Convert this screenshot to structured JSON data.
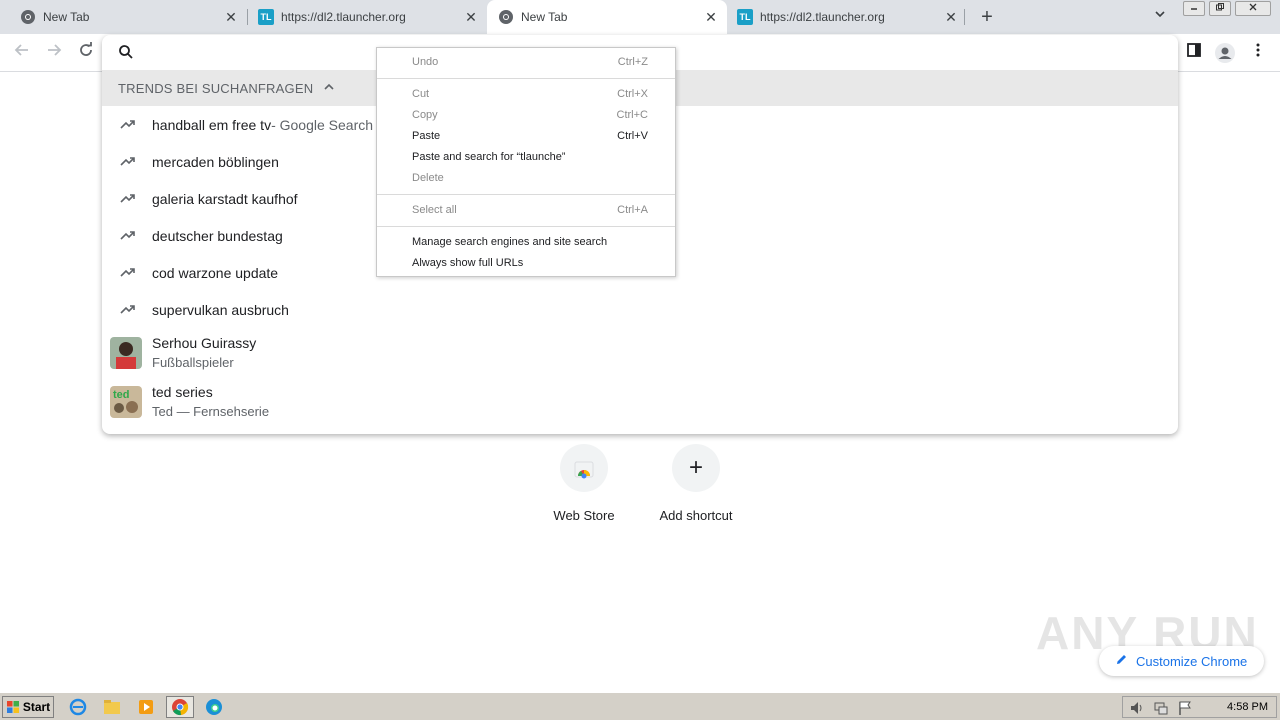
{
  "tabs": [
    {
      "title": "New Tab",
      "icon": "chrome-icon",
      "active": false
    },
    {
      "title": "https://dl2.tlauncher.org",
      "icon": "tlauncher-icon",
      "active": false
    },
    {
      "title": "New Tab",
      "icon": "chrome-icon",
      "active": true
    },
    {
      "title": "https://dl2.tlauncher.org",
      "icon": "tlauncher-icon",
      "active": false
    }
  ],
  "tlauncher_logo_text": "TL",
  "tab_close_glyph": "✕",
  "new_tab_glyph": "+",
  "omnibox": {
    "value": "",
    "placeholder": ""
  },
  "trends": {
    "header": "TRENDS BEI SUCHANFRAGEN",
    "suggestions": [
      {
        "text": "handball em free tv",
        "hint": " - Google Search"
      },
      {
        "text": "mercaden böblingen",
        "hint": ""
      },
      {
        "text": "galeria karstadt kaufhof",
        "hint": ""
      },
      {
        "text": "deutscher bundestag",
        "hint": ""
      },
      {
        "text": "cod warzone update",
        "hint": ""
      },
      {
        "text": "supervulkan ausbruch",
        "hint": ""
      }
    ],
    "entities": [
      {
        "title": "Serhou Guirassy",
        "subtitle": "Fußballspieler"
      },
      {
        "title": "ted series",
        "subtitle": "Ted — Fernsehserie",
        "thumb_text": "ted"
      }
    ]
  },
  "context_menu": {
    "undo": {
      "label": "Undo",
      "shortcut": "Ctrl+Z"
    },
    "cut": {
      "label": "Cut",
      "shortcut": "Ctrl+X"
    },
    "copy": {
      "label": "Copy",
      "shortcut": "Ctrl+C"
    },
    "paste": {
      "label": "Paste",
      "shortcut": "Ctrl+V"
    },
    "paste_search": {
      "label": "Paste and search for “tlaunche”"
    },
    "delete": {
      "label": "Delete"
    },
    "select_all": {
      "label": "Select all",
      "shortcut": "Ctrl+A"
    },
    "manage_engines": {
      "label": "Manage search engines and site search"
    },
    "show_full_urls": {
      "label": "Always show full URLs"
    }
  },
  "shortcuts": [
    {
      "label": "Web Store"
    },
    {
      "label": "Add shortcut",
      "glyph": "+"
    }
  ],
  "customize_label": "Customize Chrome",
  "watermark": "ANY RUN",
  "taskbar": {
    "start_label": "Start",
    "clock": "4:58 PM"
  },
  "colors": {
    "accent": "#1a73e8",
    "tabstrip": "#dee1e6",
    "trend_header_bg": "#e8e8e8"
  }
}
